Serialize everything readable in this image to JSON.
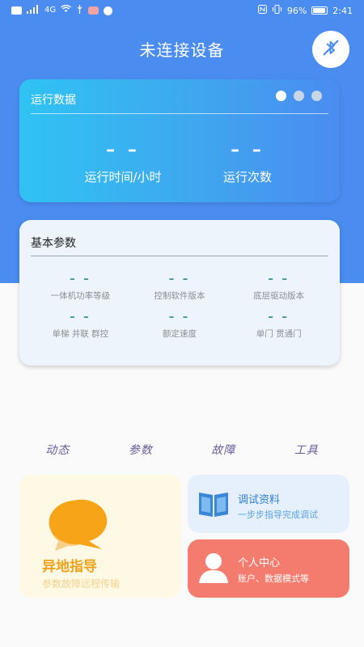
{
  "status_bar": {
    "signal_label": "4G",
    "battery_percent": "96%",
    "time": "2:41"
  },
  "header": {
    "title": "未连接设备"
  },
  "run_data": {
    "title": "运行数据",
    "stats": [
      {
        "value": "– –",
        "label": "运行时间/小时"
      },
      {
        "value": "– –",
        "label": "运行次数"
      }
    ]
  },
  "basic_params": {
    "title": "基本参数",
    "items": [
      {
        "value": "– –",
        "label": "一体机功率等级"
      },
      {
        "value": "– –",
        "label": "控制软件版本"
      },
      {
        "value": "– –",
        "label": "底层驱动版本"
      },
      {
        "value": "– –",
        "label": "单梯 并联 群控"
      },
      {
        "value": "– –",
        "label": "额定速度"
      },
      {
        "value": "– –",
        "label": "单门 贯通门"
      }
    ]
  },
  "nav_tabs": [
    "动态",
    "参数",
    "故障",
    "工具"
  ],
  "guide": {
    "title": "异地指导",
    "subtitle": "参数故障远程传输"
  },
  "docs": {
    "title": "调试资料",
    "subtitle": "一步步指导完成调试"
  },
  "profile": {
    "title": "个人中心",
    "subtitle": "账户、数据模式等"
  },
  "colors": {
    "primary_blue": "#4a8cf0",
    "card_gradient_start": "#2fc3f2",
    "param_value": "#2e8f8a",
    "guide_accent": "#f0a21c",
    "docs_accent": "#2f7fd6",
    "profile_bg": "#f47c6f"
  }
}
